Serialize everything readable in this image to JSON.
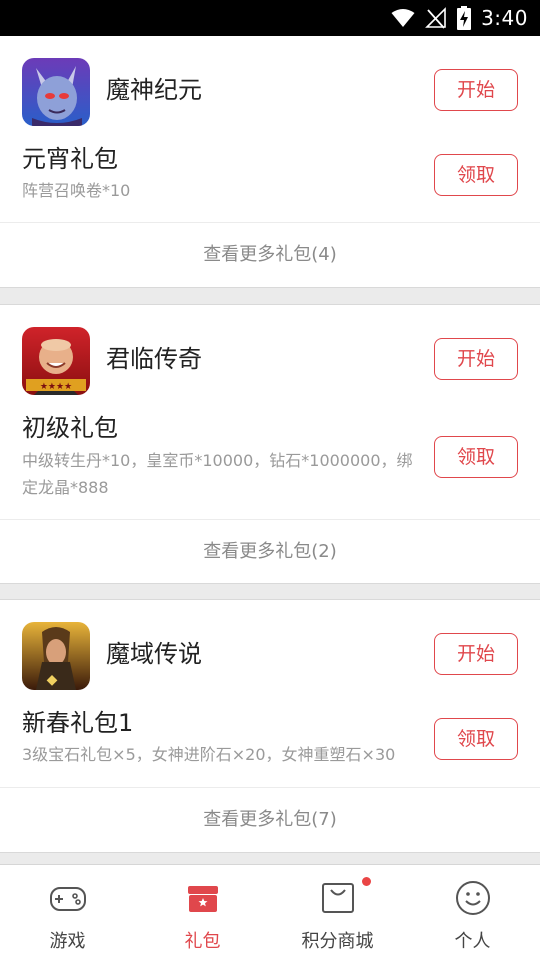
{
  "status": {
    "time": "3:40"
  },
  "cards": [
    {
      "game": "魔神纪元",
      "start_label": "开始",
      "gift_title": "元宵礼包",
      "gift_desc": "阵营召唤卷*10",
      "claim_label": "领取",
      "more_label": "查看更多礼包(4)"
    },
    {
      "game": "君临传奇",
      "start_label": "开始",
      "gift_title": "初级礼包",
      "gift_desc": "中级转生丹*10，皇室币*10000，钻石*1000000，绑定龙晶*888",
      "claim_label": "领取",
      "more_label": "查看更多礼包(2)"
    },
    {
      "game": "魔域传说",
      "start_label": "开始",
      "gift_title": "新春礼包1",
      "gift_desc": "3级宝石礼包×5，女神进阶石×20，女神重塑石×30",
      "claim_label": "领取",
      "more_label": "查看更多礼包(7)"
    }
  ],
  "tabs": [
    {
      "label": "游戏",
      "icon": "gamepad-icon",
      "active": false
    },
    {
      "label": "礼包",
      "icon": "gift-box-icon",
      "active": true
    },
    {
      "label": "积分商城",
      "icon": "shopping-bag-icon",
      "active": false,
      "badge": true
    },
    {
      "label": "个人",
      "icon": "smiley-icon",
      "active": false
    }
  ],
  "colors": {
    "accent": "#e0474c",
    "badge": "#ea4545"
  }
}
